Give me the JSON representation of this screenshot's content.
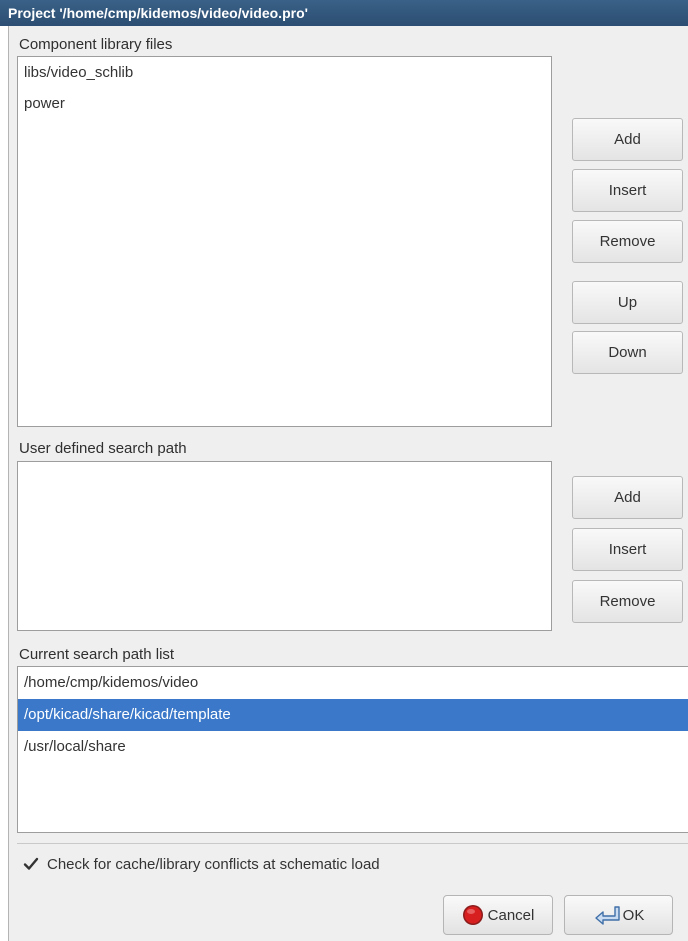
{
  "window": {
    "title": "Project '/home/cmp/kidemos/video/video.pro'"
  },
  "component_libraries": {
    "label": "Component library files",
    "items": [
      "libs/video_schlib",
      "power"
    ],
    "buttons": {
      "add": "Add",
      "insert": "Insert",
      "remove": "Remove",
      "up": "Up",
      "down": "Down"
    }
  },
  "user_search_path": {
    "label": "User defined search path",
    "items": [],
    "buttons": {
      "add": "Add",
      "insert": "Insert",
      "remove": "Remove"
    }
  },
  "current_search_path": {
    "label": "Current search path list",
    "items": [
      "/home/cmp/kidemos/video",
      "/opt/kicad/share/kicad/template",
      "/usr/local/share"
    ],
    "selected_index": 1
  },
  "options": {
    "check_conflicts_label": "Check for cache/library conflicts at schematic load",
    "check_conflicts_checked": true
  },
  "footer": {
    "cancel_label": "Cancel",
    "ok_label": "OK"
  },
  "colors": {
    "title_bar": "#2c4e72",
    "selection": "#3b78c9",
    "dialog_bg": "#efefef"
  },
  "icons": {
    "cancel": "stop-icon",
    "ok": "ok-arrow-icon",
    "checkbox": "checkmark-icon"
  }
}
